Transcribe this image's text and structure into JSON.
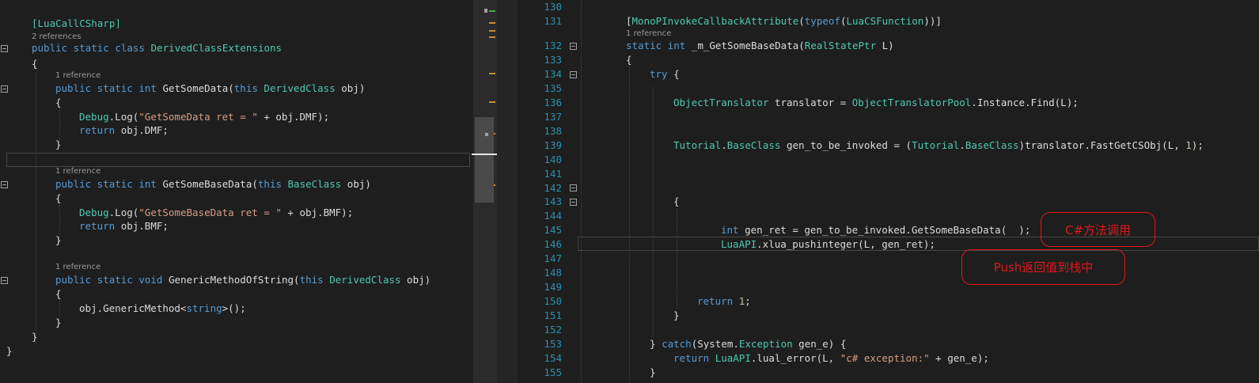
{
  "left": {
    "l1": "[LuaCallCSharp]",
    "ref2": "2 references",
    "l2a": "public static class ",
    "l2b": "DerivedClassExtensions",
    "l3": "{",
    "ref1": "1 reference",
    "l4a": "public static int ",
    "l4b": "GetSomeData(",
    "l4c": "this ",
    "l4d": "DerivedClass",
    "l4e": " obj)",
    "l5": "{",
    "l6a": "Debug",
    ".l6b": "",
    "l6b": ".Log(",
    "l6c": "\"GetSomeData ret = \"",
    "l6d": " + obj.DMF);",
    "l7a": "return ",
    "l7b": "obj.DMF;",
    "l8": "}",
    "ref3": "1 reference",
    "l9a": "public static int ",
    "l9b": "GetSomeBaseData(",
    "l9c": "this ",
    "l9d": "BaseClass",
    "l9e": " obj)",
    "l10": "{",
    "l11a": "Debug",
    "l11b": ".Log(",
    "l11c": "\"GetSomeBaseData ret = \"",
    "l11d": " + obj.BMF);",
    "l12a": "return ",
    "l12b": "obj.BMF;",
    "l13": "}",
    "ref4": "1 reference",
    "l14a": "public static void ",
    "l14b": "GenericMethodOfString(",
    "l14c": "this ",
    "l14d": "DerivedClass",
    "l14e": " obj)",
    "l15": "{",
    "l16a": "obj.GenericMethod<",
    "l16b": "string",
    "l16c": ">();",
    "l17": "}",
    "l18": "}",
    "l19": "}"
  },
  "right": {
    "lines": [
      "130",
      "131",
      "132",
      "133",
      "134",
      "135",
      "136",
      "137",
      "138",
      "139",
      "140",
      "141",
      "142",
      "143",
      "144",
      "145",
      "146",
      "147",
      "148",
      "149",
      "150",
      "151",
      "152",
      "153",
      "154",
      "155"
    ],
    "attr_a": "[",
    "attr_b": "MonoPInvokeCallback",
    "attr_c": "Attribute",
    "attr_d": "(",
    "attr_e": "typeof",
    "attr_f": "(",
    "attr_g": "LuaCSFunction",
    "attr_h": "))]",
    "ref": "1 reference",
    "sig_a": "static int ",
    "sig_b": "_m_GetSomeBaseData(",
    "sig_c": "RealStatePtr",
    "sig_d": " L)",
    "open1": "{",
    "try_a": "try",
    " try_b": "",
    "try_b": " {",
    "ot_a": "ObjectTranslator",
    "ot_b": " translator = ",
    "ot_c": "ObjectTranslatorPool",
    "ot_d": ".Instance.Find(L);",
    "tu_a": "Tutorial",
    "tu_b": ".",
    "tu_c": "BaseClass",
    "tu_d": " gen_to_be_invoked = (",
    "tu_e": "Tutorial",
    "tu_f": ".",
    "tu_g": "BaseClass",
    "tu_h": ")translator.FastGetCSObj(L, ",
    "tu_i": "1",
    "tu_j": ");",
    "brace143": "{",
    "g_a": "int ",
    "g_b": "gen_ret = gen_to_be_invoked.GetSomeBaseData(  );",
    "p_a": "LuaAPI",
    "p_b": ".xlua_pushinteger(L, gen_ret);",
    "r_a": "return ",
    "r_b": "1",
    "r_c": ";",
    "close151": "}",
    "c_a": "} ",
    "c_b": "catch",
    "c_c": "(System.",
    "c_d": "Exception",
    "c_e": " gen_e) {",
    "e_a": "return ",
    "e_b": "LuaAPI",
    "e_c": ".lual_error(L, ",
    "e_d": "\"c# exception:\"",
    "e_e": " + gen_e);",
    "close155": "}"
  },
  "callouts": {
    "call": "C#方法调用",
    "push": "Push返回值到栈中"
  },
  "colors": {
    "keyword": "#569cd6",
    "type": "#4ec9b0",
    "string": "#d69d85",
    "number": "#b5cea8",
    "linenum": "#2b91af",
    "callout": "#e0181a"
  }
}
